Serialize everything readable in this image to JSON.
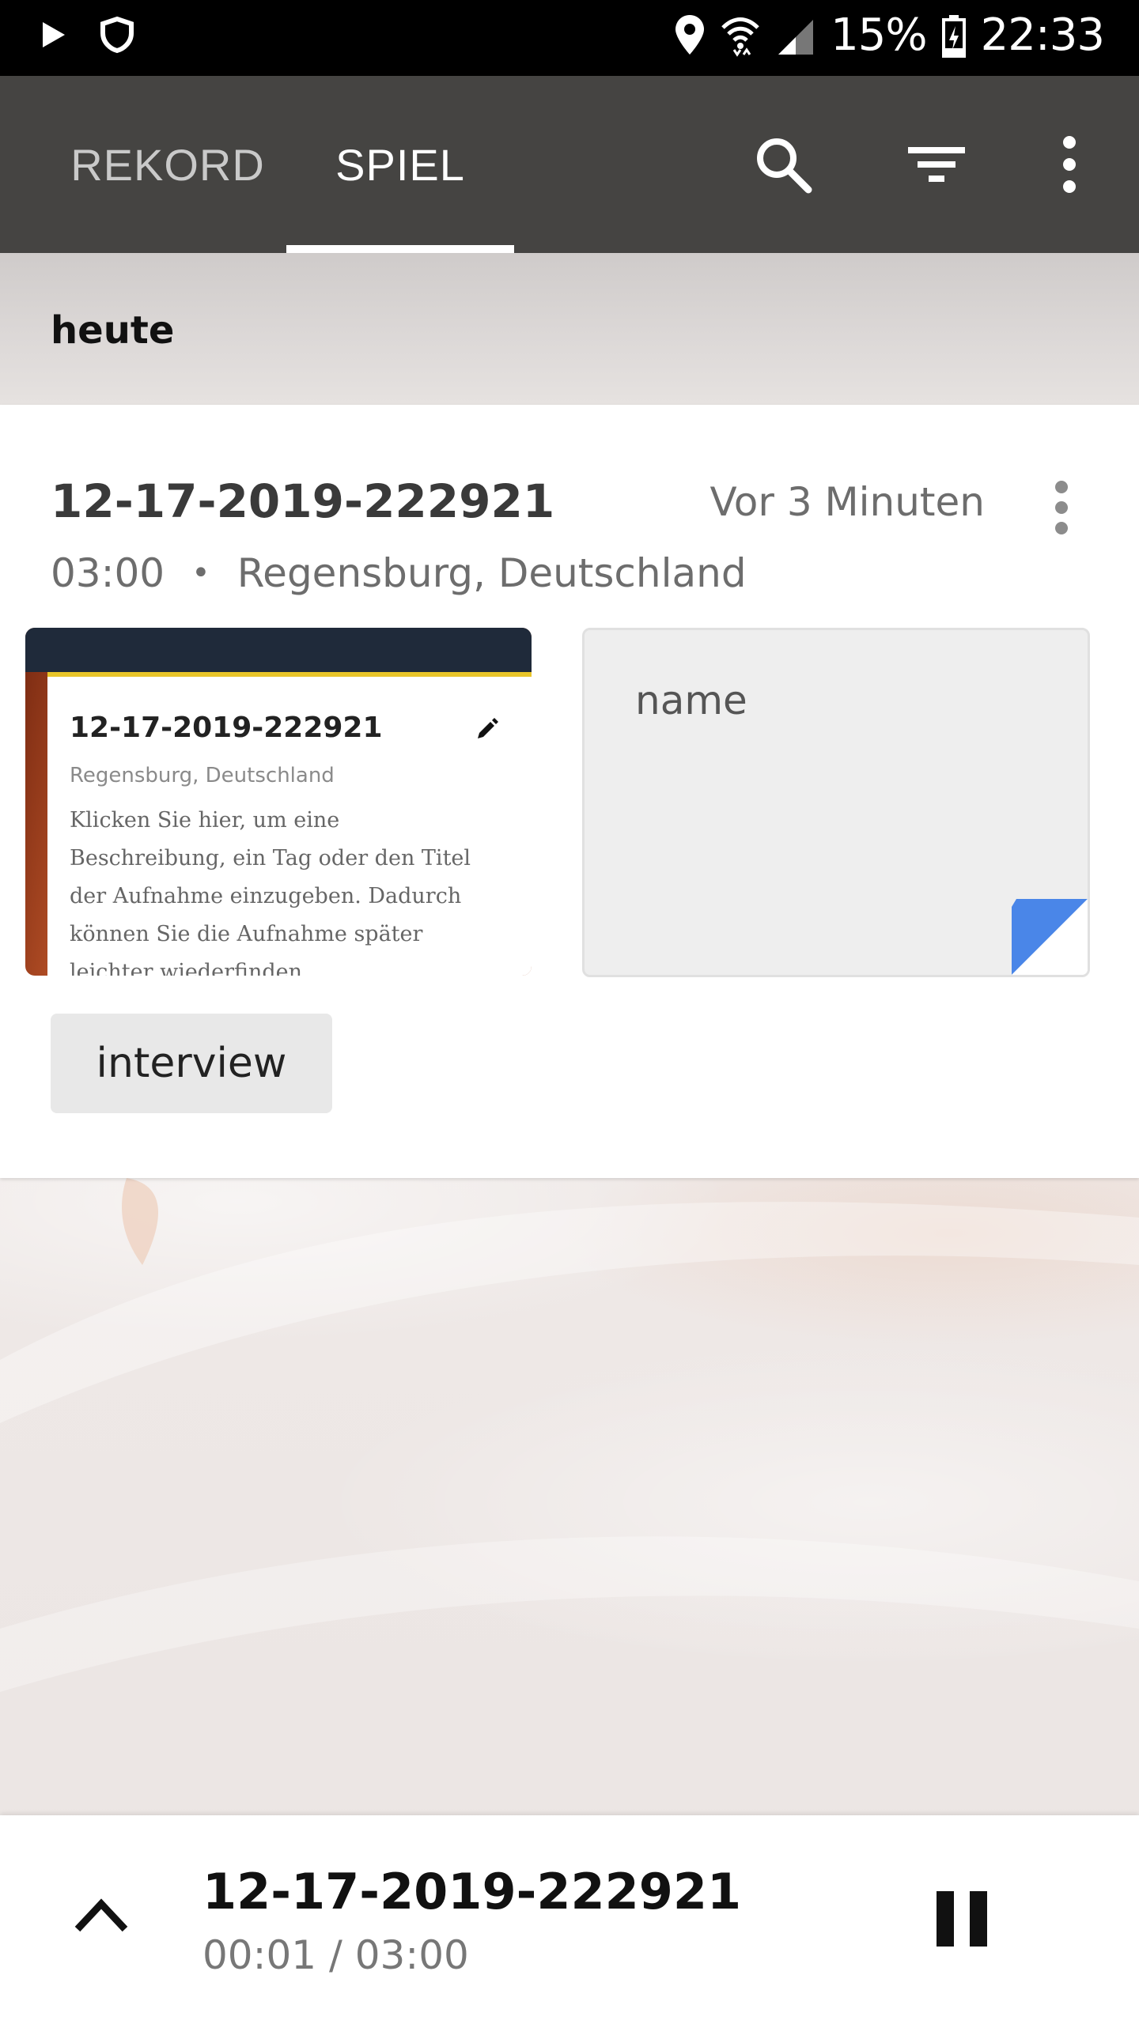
{
  "status_bar": {
    "battery": "15%",
    "time": "22:33",
    "icons": [
      "play-icon",
      "shield-icon",
      "location-icon",
      "wifi-icon",
      "signal-icon",
      "battery-icon"
    ]
  },
  "app_bar": {
    "tabs": [
      {
        "label": "REKORD",
        "selected": false
      },
      {
        "label": "SPIEL",
        "selected": true
      }
    ],
    "actions": [
      "search-icon",
      "filter-icon",
      "more-vert-icon"
    ]
  },
  "section": {
    "header": "heute"
  },
  "recording": {
    "title": "12-17-2019-222921",
    "time_ago": "Vor 3 Minuten",
    "duration": "03:00",
    "separator": "•",
    "location": "Regensburg, Deutschland",
    "thumbnail": {
      "title": "12-17-2019-222921",
      "location": "Regensburg, Deutschland",
      "description": "Klicken Sie hier, um eine Beschreibung, ein Tag oder den Titel der Aufnahme einzugeben. Dadurch können Sie die Aufnahme später leichter wiederfinden."
    },
    "note": {
      "label": "name"
    },
    "tag": "interview"
  },
  "player": {
    "title": "12-17-2019-222921",
    "progress": "00:01 / 03:00",
    "colors": {
      "accent_fold": "#4a86e8",
      "thumb_stripe": "#e9c529"
    }
  }
}
